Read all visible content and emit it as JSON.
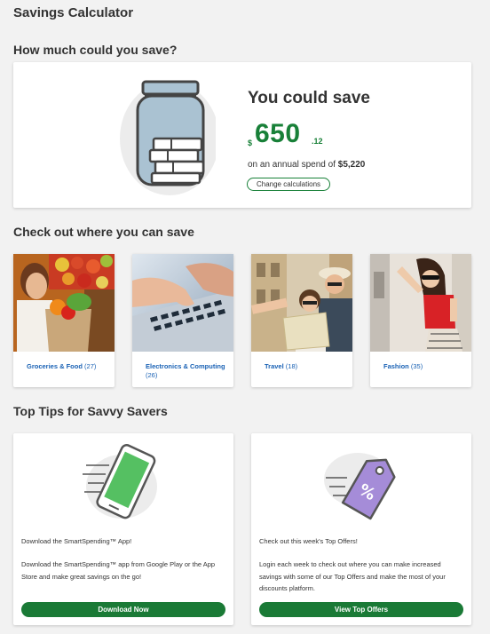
{
  "page": {
    "title": "Savings Calculator"
  },
  "savings": {
    "section_title": "How much could you save?",
    "heading": "You could save",
    "currency": "$",
    "amount_main": "650",
    "amount_cents": ".12",
    "spend_prefix": "on an annual spend of ",
    "spend_value": "$5,220",
    "change_button": "Change calculations"
  },
  "categories": {
    "section_title": "Check out where you can save",
    "items": [
      {
        "label": "Groceries & Food",
        "count": "(27)"
      },
      {
        "label": "Electronics & Computing",
        "count": "(26)"
      },
      {
        "label": "Travel",
        "count": "(18)"
      },
      {
        "label": "Fashion",
        "count": "(35)"
      }
    ]
  },
  "tips": {
    "section_title": "Top Tips for Savvy Savers",
    "items": [
      {
        "title": "Download the SmartSpending™ App!",
        "body": "Download the SmartSpending™ app from Google Play or the App Store and make great savings on the go!",
        "button": "Download Now"
      },
      {
        "title": "Check out this week's Top Offers!",
        "body": "Login each week to check out where you can make increased savings with some of our Top Offers and make the most of your discounts platform.",
        "button": "View Top Offers"
      }
    ]
  },
  "colors": {
    "accent_green": "#188038",
    "button_green": "#1a7a36",
    "link_blue": "#1a62b5",
    "background": "#f2f2f2"
  },
  "icons": [
    "savings-jar-icon",
    "phone-app-icon",
    "discount-tag-icon"
  ]
}
